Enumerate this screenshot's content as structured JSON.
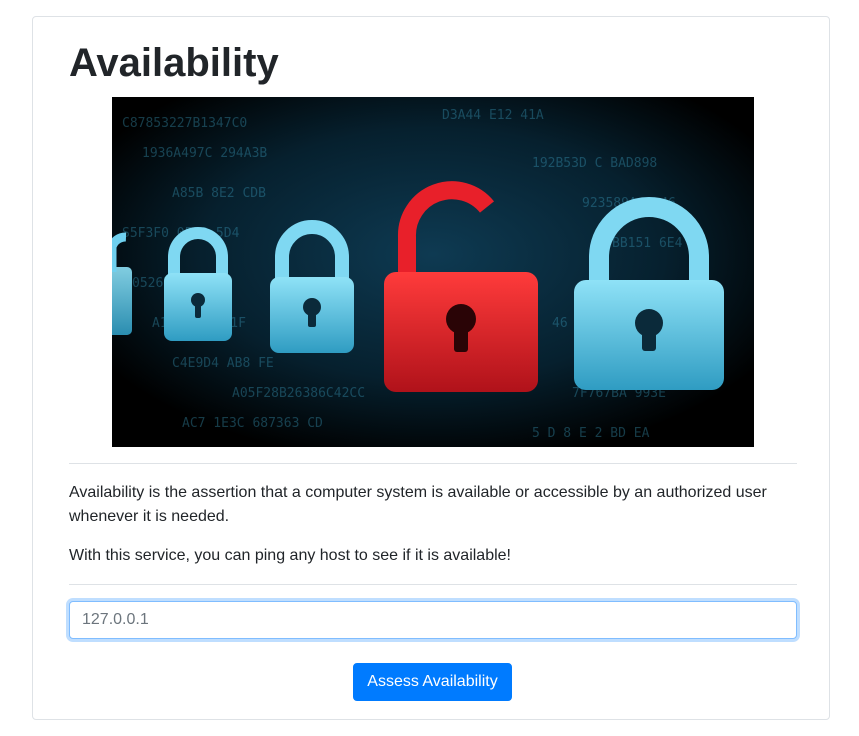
{
  "page": {
    "title": "Availability"
  },
  "hero_image": {
    "subject": "padlocks over digital code",
    "colors": {
      "closed_lock": "#63c7e6",
      "open_lock": "#e8202a",
      "background": "#000000"
    }
  },
  "content": {
    "paragraph_1": "Availability is the assertion that a computer system is available or accessible by an authorized user whenever it is needed.",
    "paragraph_2": "With this service, you can ping any host to see if it is available!"
  },
  "form": {
    "host_input": {
      "placeholder": "127.0.0.1",
      "value": ""
    },
    "submit_label": "Assess Availability"
  },
  "colors": {
    "accent": "#007bff",
    "input_focus_border": "#80bdff",
    "text": "#212529",
    "divider": "#dee2e6"
  }
}
